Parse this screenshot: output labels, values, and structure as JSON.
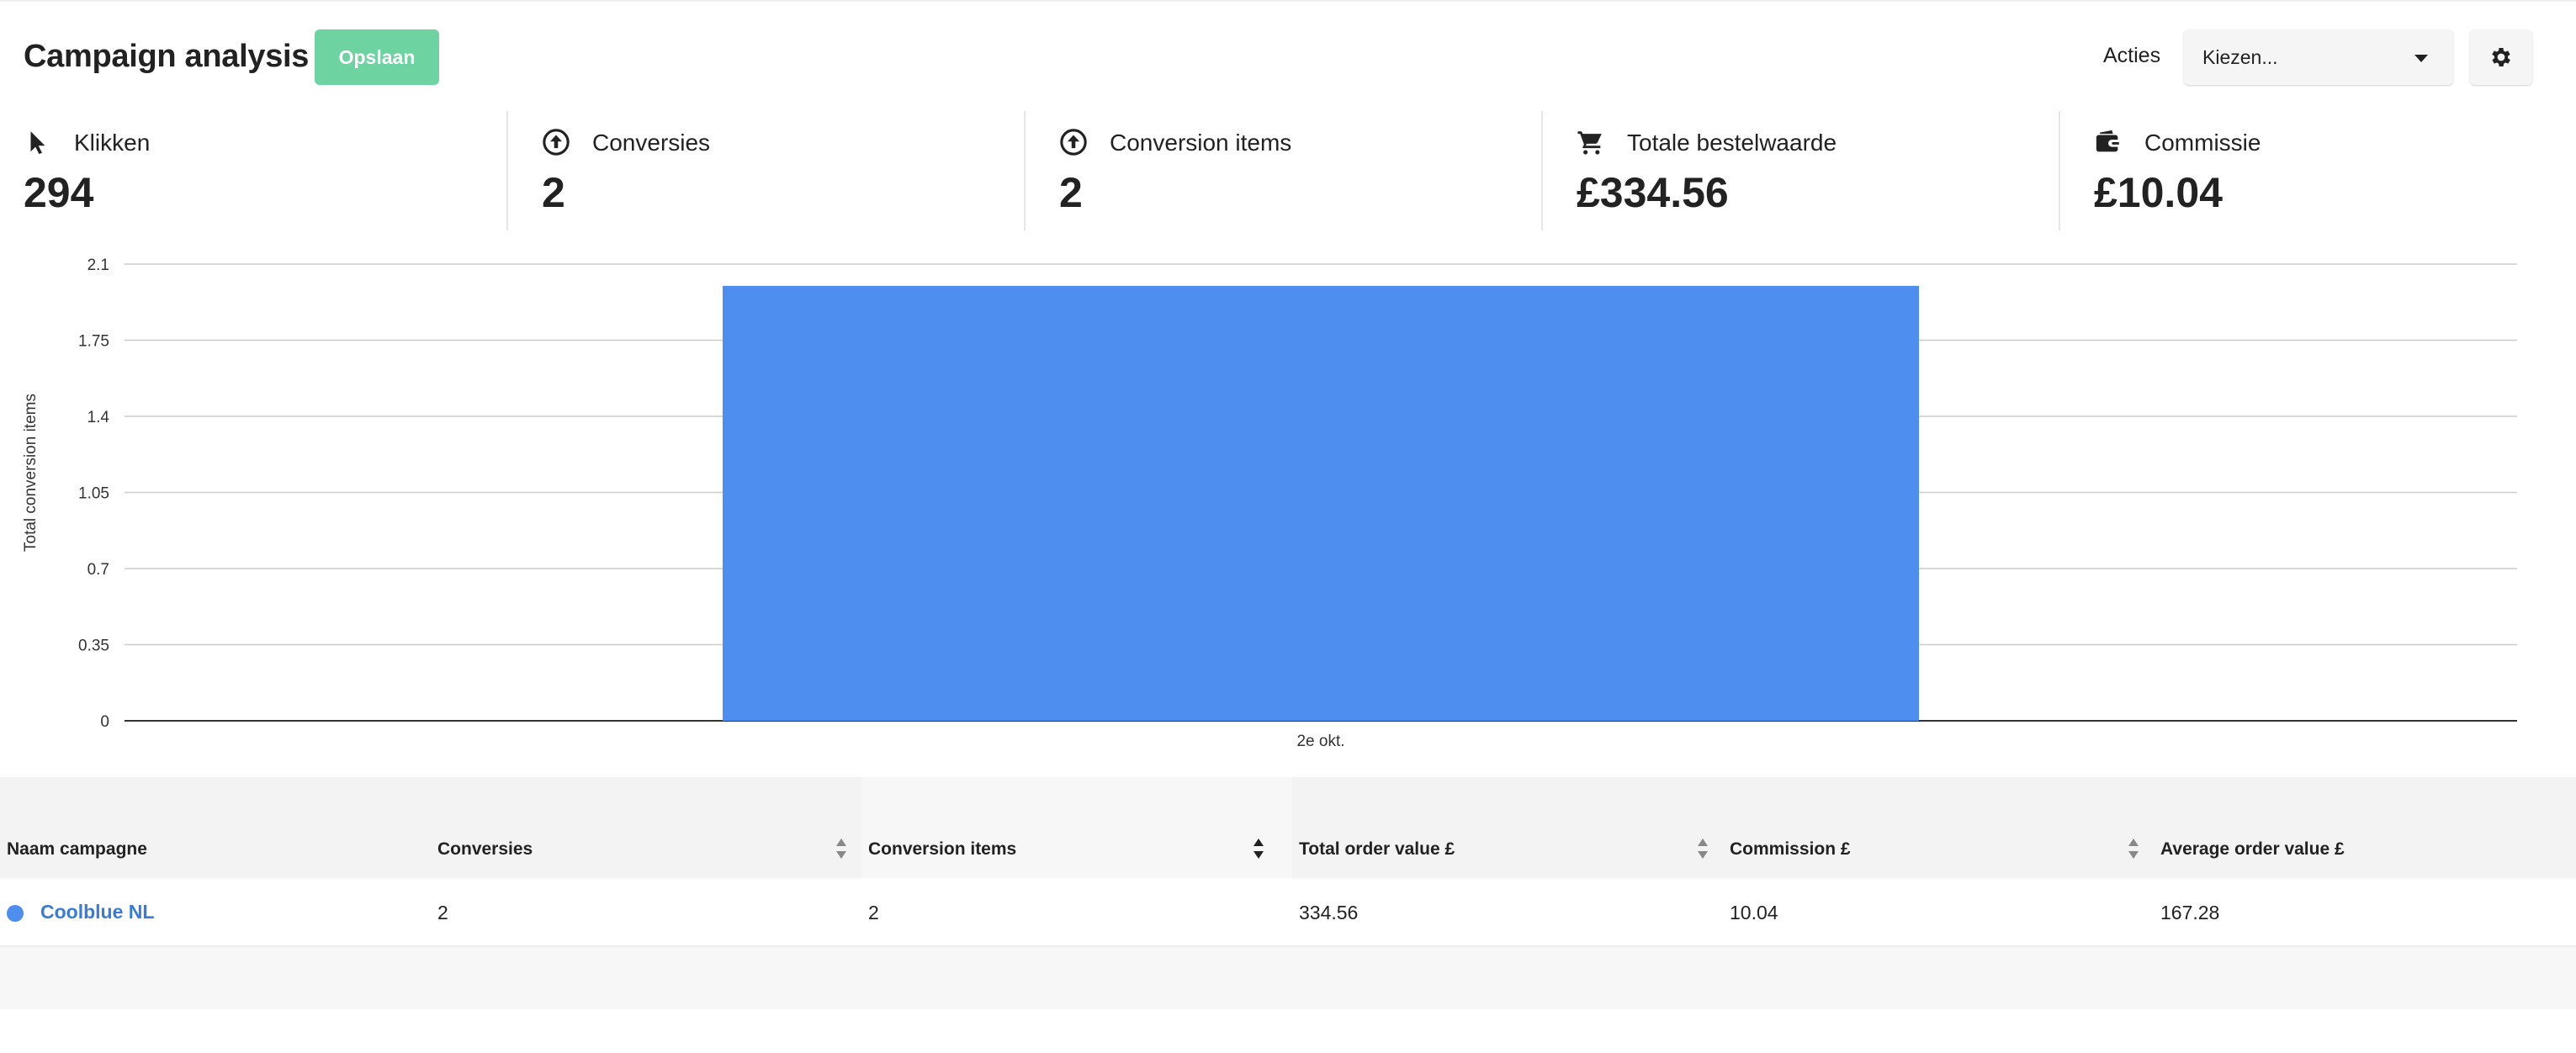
{
  "header": {
    "title": "Campaign analysis",
    "save_label": "Opslaan",
    "actions_label": "Acties",
    "select_value": "Kiezen..."
  },
  "kpis": [
    {
      "icon": "cursor-icon",
      "label": "Klikken",
      "value": "294"
    },
    {
      "icon": "arrow-up-circle-icon",
      "label": "Conversies",
      "value": "2"
    },
    {
      "icon": "arrow-up-circle-icon",
      "label": "Conversion items",
      "value": "2"
    },
    {
      "icon": "cart-icon",
      "label": "Totale bestelwaarde",
      "value": "£334.56"
    },
    {
      "icon": "wallet-icon",
      "label": "Commissie",
      "value": "£10.04"
    }
  ],
  "chart_data": {
    "type": "bar",
    "categories": [
      "2e okt."
    ],
    "values": [
      2
    ],
    "ylabel": "Total conversion items",
    "yticks": [
      "0",
      "0.35",
      "0.7",
      "1.05",
      "1.4",
      "1.75",
      "2.1"
    ],
    "ylim": [
      0,
      2.1
    ],
    "grid": true,
    "bar_color": "#4d8eef"
  },
  "table": {
    "columns": [
      {
        "label": "Naam campagne",
        "sortable": false
      },
      {
        "label": "Conversies",
        "sortable": true
      },
      {
        "label": "Conversion items",
        "sortable": true,
        "active": true
      },
      {
        "label": "Total order value £",
        "sortable": true
      },
      {
        "label": "Commission £",
        "sortable": true
      },
      {
        "label": "Average order value £",
        "sortable": false
      }
    ],
    "rows": [
      {
        "campaign": "Coolblue NL",
        "conversions": "2",
        "items": "2",
        "order_value": "334.56",
        "commission": "10.04",
        "avg_order_value": "167.28"
      }
    ]
  },
  "colors": {
    "accent": "#4d8eef",
    "save_button": "#6dd3a0",
    "link": "#3a7bd5"
  }
}
